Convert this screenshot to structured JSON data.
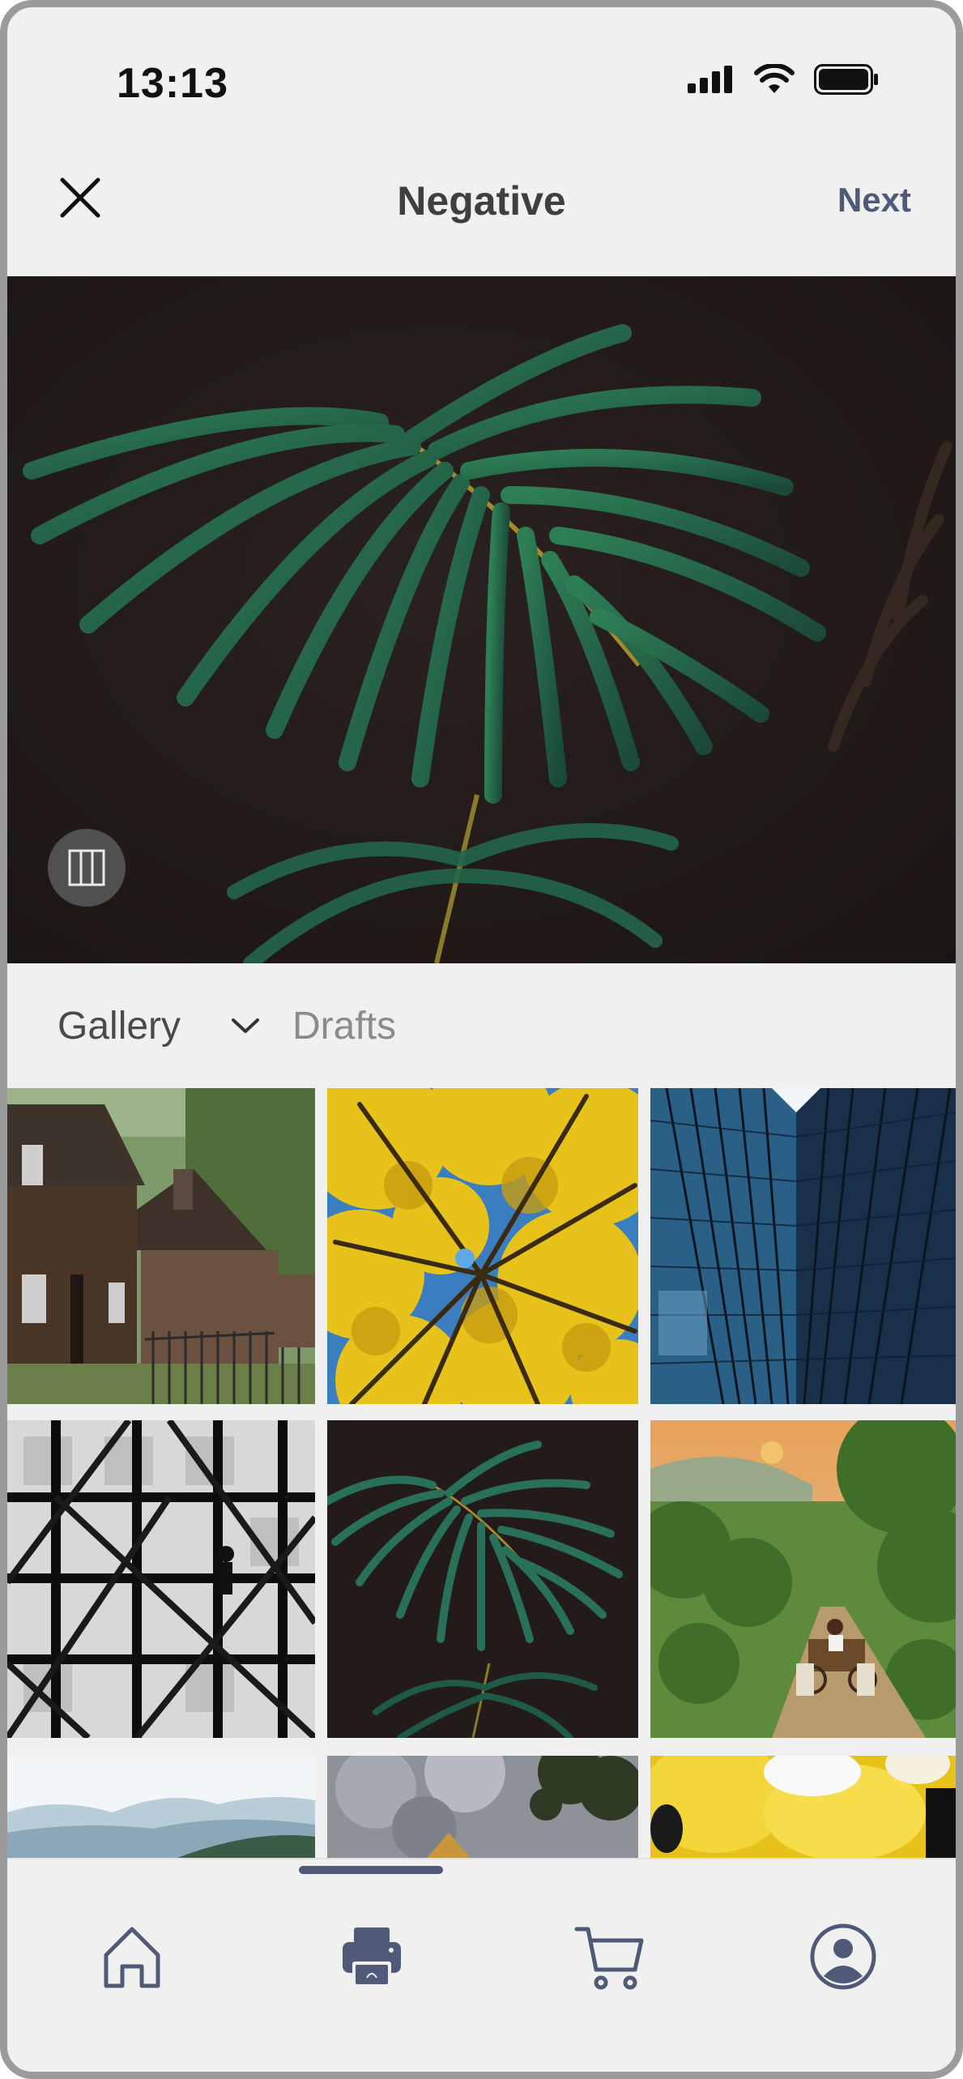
{
  "status_bar": {
    "time": "13:13",
    "icons": [
      "cellular-signal-icon",
      "wifi-icon",
      "battery-icon"
    ]
  },
  "header": {
    "title": "Negative",
    "close_icon": "close-icon",
    "next_label": "Next"
  },
  "preview": {
    "subject": "palm frond on dark background",
    "aspect_toggle_icon": "aspect-ratio-icon"
  },
  "source": {
    "gallery_label": "Gallery",
    "dropdown_icon": "chevron-down-icon",
    "drafts_label": "Drafts"
  },
  "gallery": {
    "thumbnails": [
      "wooden houses",
      "yellow trees from below",
      "glass skyscraper",
      "black and white staircases",
      "palm frond",
      "bullock cart on country road",
      "misty mountains",
      "storm clouds over hut",
      "yellow flower petals"
    ]
  },
  "tab_bar": {
    "tabs": [
      {
        "name": "home",
        "icon": "home-icon"
      },
      {
        "name": "print",
        "icon": "printer-icon",
        "active": true
      },
      {
        "name": "cart",
        "icon": "cart-icon"
      },
      {
        "name": "profile",
        "icon": "profile-icon"
      }
    ]
  },
  "colors": {
    "accent": "#4f5a78",
    "background": "#f0f0f0",
    "title_text": "#3f3f3f",
    "inactive_text": "#8b8b8b"
  }
}
